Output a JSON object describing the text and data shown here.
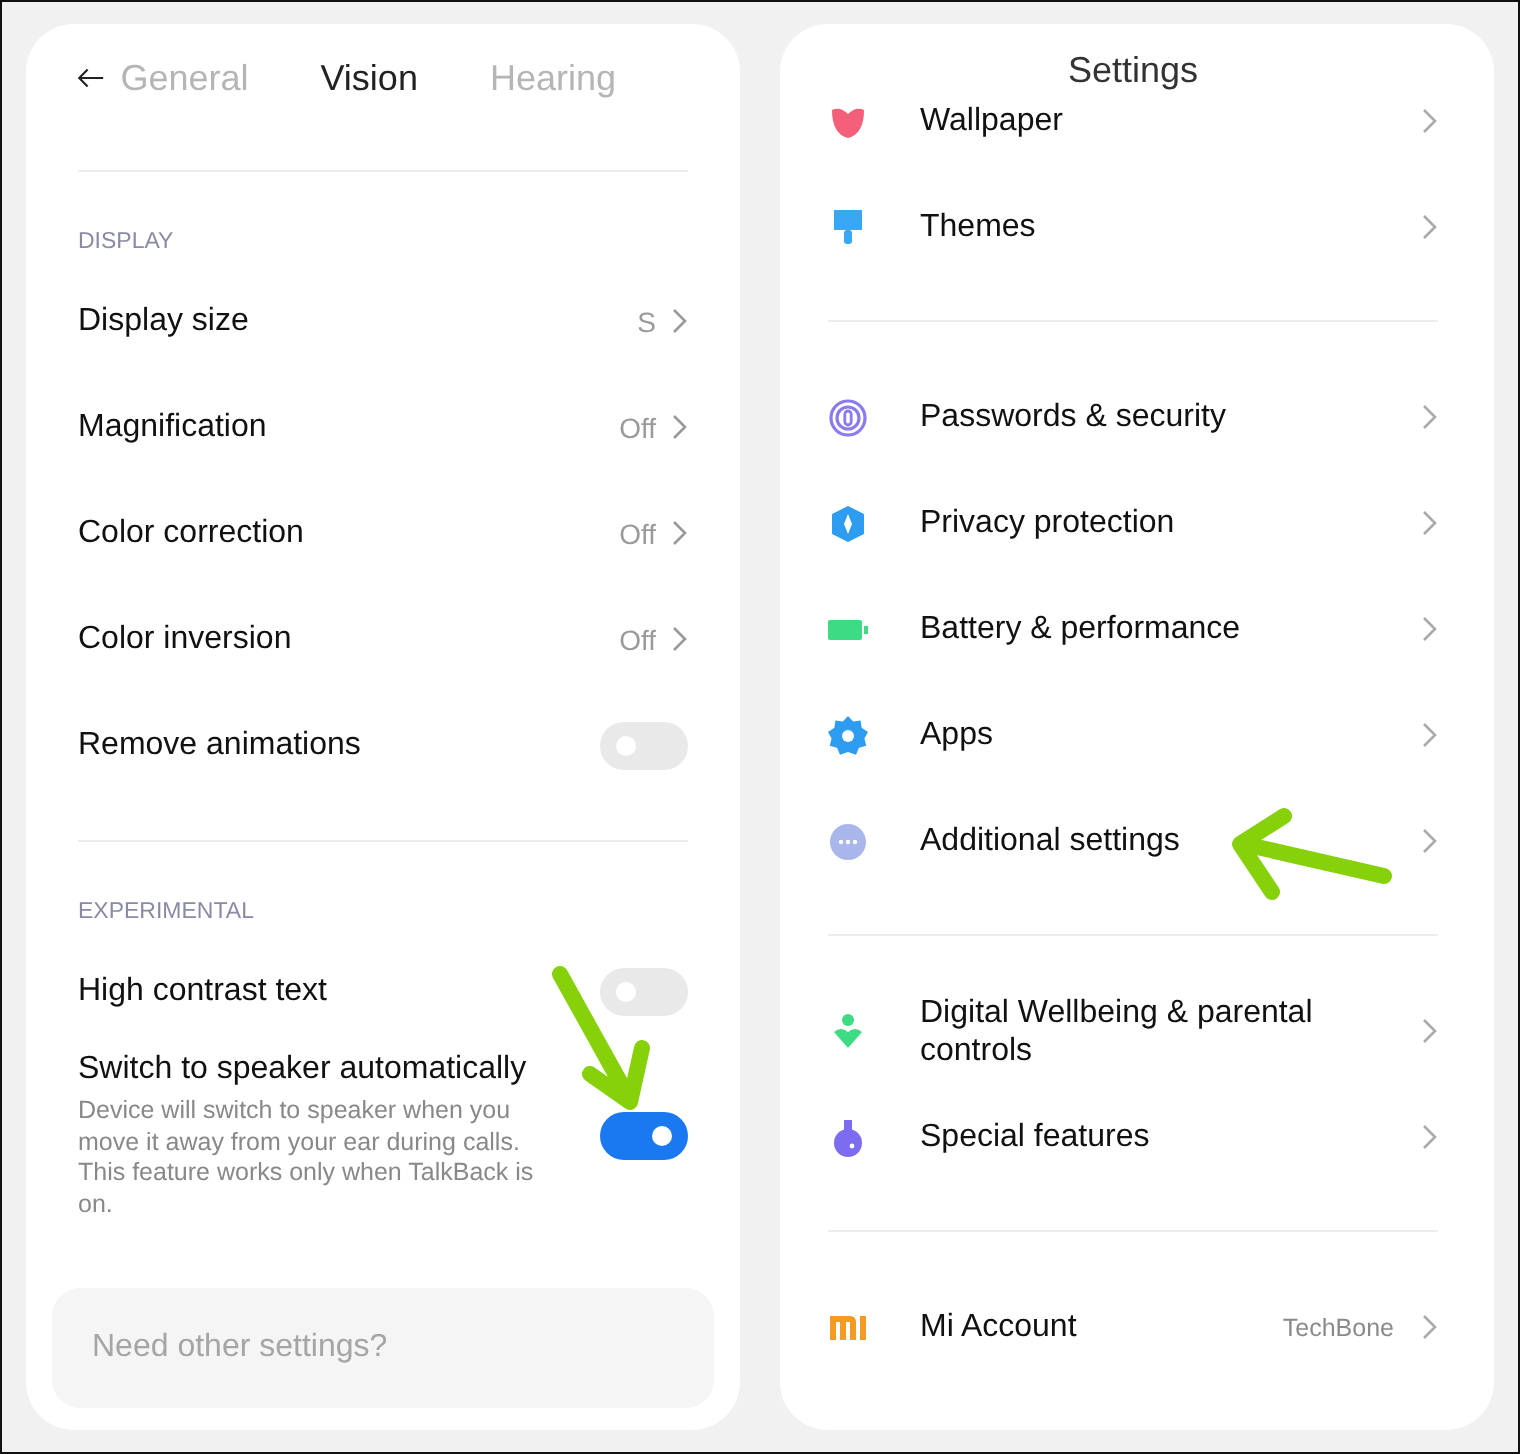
{
  "vision_screen": {
    "tabs": [
      {
        "label": "General",
        "selected": false
      },
      {
        "label": "Vision",
        "selected": true
      },
      {
        "label": "Hearing",
        "selected": false
      }
    ],
    "sections": [
      {
        "heading": "DISPLAY",
        "items": [
          {
            "kind": "nav",
            "label": "Display size",
            "value": "S"
          },
          {
            "kind": "nav",
            "label": "Magnification",
            "value": "Off"
          },
          {
            "kind": "nav",
            "label": "Color correction",
            "value": "Off"
          },
          {
            "kind": "nav",
            "label": "Color inversion",
            "value": "Off"
          },
          {
            "kind": "toggle",
            "label": "Remove animations",
            "on": false
          }
        ]
      },
      {
        "heading": "EXPERIMENTAL",
        "items": [
          {
            "kind": "toggle",
            "label": "High contrast text",
            "on": false
          },
          {
            "kind": "toggle",
            "label": "Switch to speaker automatically",
            "description": "Device will switch to speaker when you move it away from your ear during calls. This feature works only when TalkBack is on.",
            "on": true
          }
        ]
      }
    ],
    "footer_card": {
      "text": "Need other settings?"
    }
  },
  "settings_screen": {
    "title": "Settings",
    "groups": [
      [
        {
          "label": "Wallpaper"
        },
        {
          "label": "Themes"
        }
      ],
      [
        {
          "label": "Passwords & security"
        },
        {
          "label": "Privacy protection"
        },
        {
          "label": "Battery & performance"
        },
        {
          "label": "Apps"
        },
        {
          "label": "Additional settings"
        }
      ],
      [
        {
          "label": "Digital Wellbeing & parental controls"
        },
        {
          "label": "Special features"
        }
      ],
      [
        {
          "label": "Mi Account",
          "value": "TechBone"
        }
      ]
    ]
  }
}
